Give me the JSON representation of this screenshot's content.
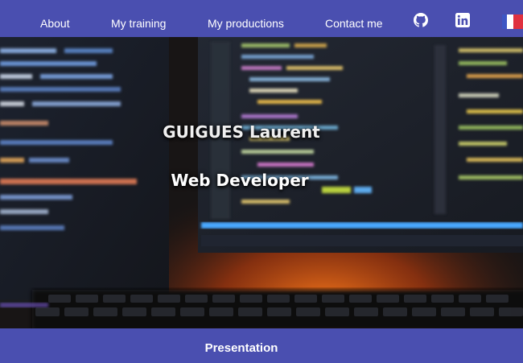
{
  "nav": {
    "about": "About",
    "training": "My training",
    "productions": "My productions",
    "contact": "Contact me",
    "icons": [
      "github-icon",
      "linkedin-icon",
      "french-flag-icon"
    ],
    "background_color": "#4a4fb0"
  },
  "hero": {
    "name": "GUIGUES Laurent",
    "role": "Web Developer"
  },
  "section": {
    "title": "Presentation",
    "background_color": "#4a4fb0"
  }
}
